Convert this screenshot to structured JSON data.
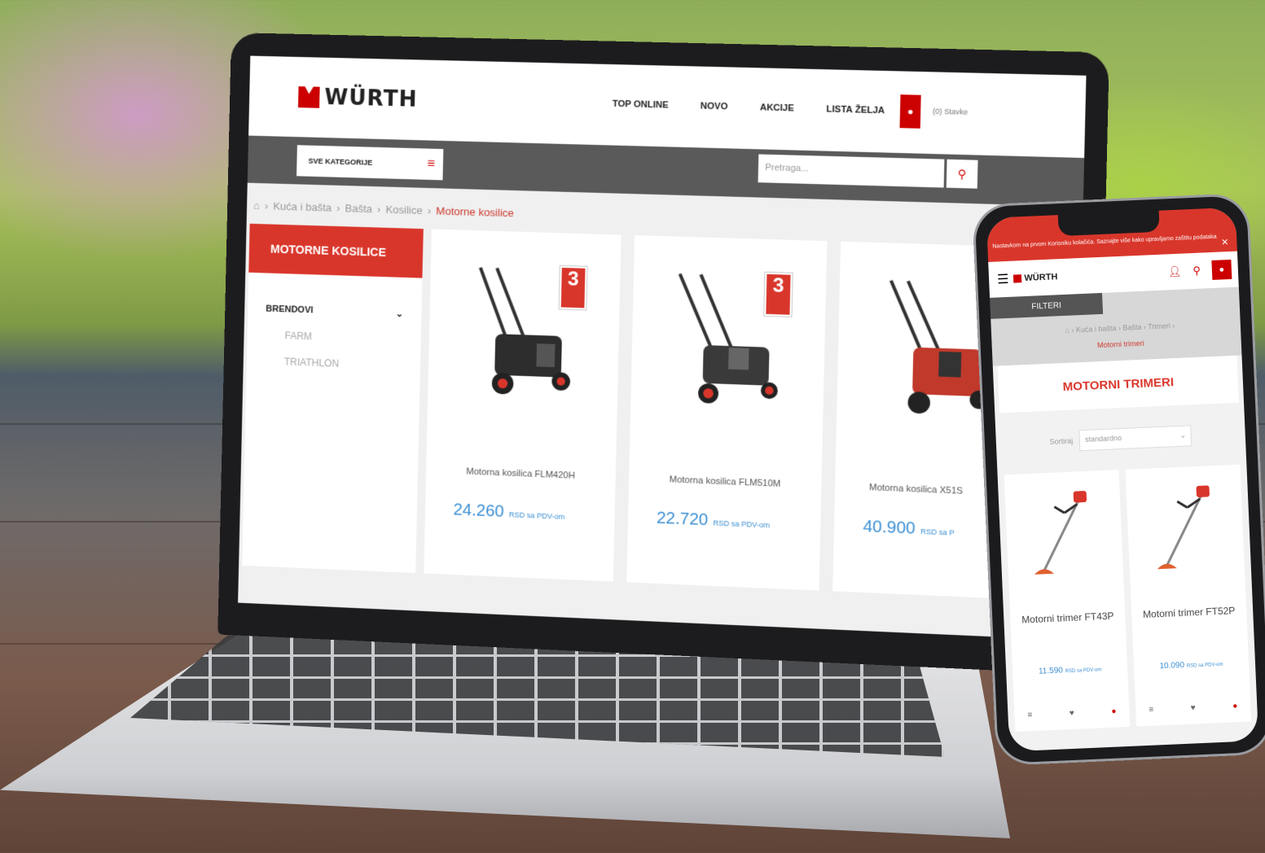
{
  "laptop": {
    "logo": "WÜRTH",
    "nav": [
      "TOP ONLINE",
      "NOVO",
      "AKCIJE",
      "LISTA ŽELJA"
    ],
    "cart_label": "(0) Stavke",
    "categories_button": "SVE KATEGORIJE",
    "search_placeholder": "Pretraga...",
    "breadcrumb": [
      "Kuća i bašta",
      "Bašta",
      "Kosilice"
    ],
    "breadcrumb_current": "Motorne kosilice",
    "sidebar": {
      "title": "MOTORNE KOSILICE",
      "section": "BRENDOVI",
      "brands": [
        "FARM",
        "TRIATHLON"
      ]
    },
    "products": [
      {
        "name": "Motorna kosilica FLM420H",
        "price": "24.260",
        "price_suffix": "RSD sa PDV-om",
        "badge": "3"
      },
      {
        "name": "Motorna kosilica FLM510M",
        "price": "22.720",
        "price_suffix": "RSD sa PDV-om",
        "badge": "3"
      },
      {
        "name": "Motorna kosilica X51S",
        "price": "40.900",
        "price_suffix": "RSD sa P",
        "badge": ""
      }
    ]
  },
  "phone": {
    "cookie_text": "Nastavkom na prvom Korisniku kolačića. Saznajte više kako upravljamo zaštitu podataka",
    "logo": "WÜRTH",
    "filters_button": "FILTERI",
    "breadcrumb": [
      "Kuća i bašta",
      "Bašta",
      "Trimeri"
    ],
    "breadcrumb_current": "Motorni trimeri",
    "title": "MOTORNI TRIMERI",
    "sort_label": "Sortiraj",
    "sort_value": "standardno",
    "products": [
      {
        "name": "Motorni trimer FT43P",
        "price": "11.590",
        "price_suffix": "RSD sa PDV-om"
      },
      {
        "name": "Motorni trimer FT52P",
        "price": "10.090",
        "price_suffix": "RSD sa PDV-om"
      }
    ]
  },
  "colors": {
    "brand_red": "#d9362b",
    "price_blue": "#3b8fd4",
    "nav_gray": "#5a5a5a"
  }
}
